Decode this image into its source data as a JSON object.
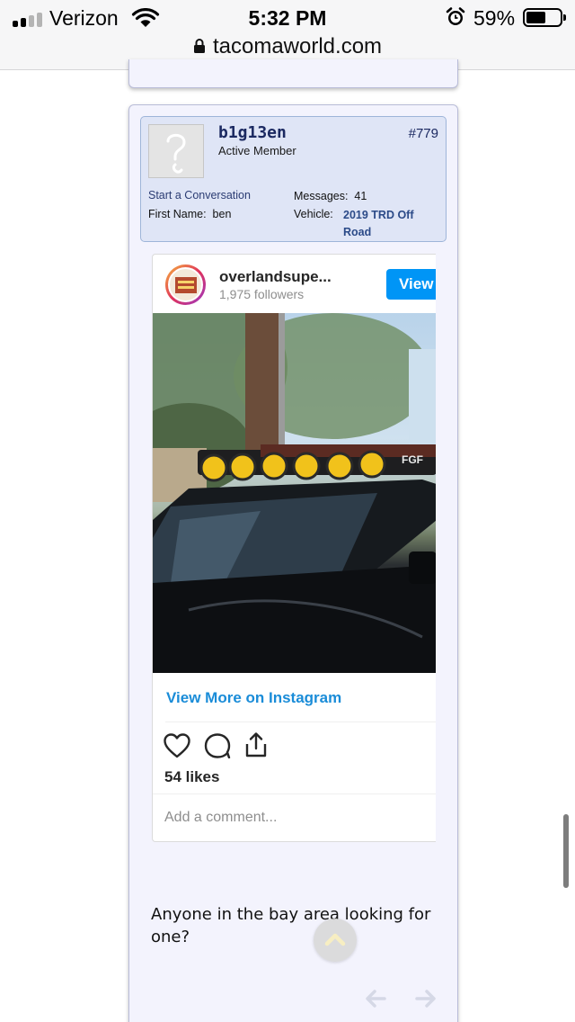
{
  "status_bar": {
    "carrier": "Verizon",
    "time": "5:32 PM",
    "battery_percent": "59%",
    "battery_level": 0.59,
    "signal_bars": 2,
    "icons": [
      "signal-icon",
      "wifi-icon",
      "alarm-icon",
      "battery-icon"
    ]
  },
  "url_bar": {
    "domain": "tacomaworld.com",
    "icon": "lock-icon"
  },
  "post": {
    "user": {
      "username": "b1g13en",
      "title": "Active Member",
      "post_number": "#779",
      "start_conversation": "Start a Conversation",
      "first_name_label": "First Name:",
      "first_name": "ben",
      "messages_label": "Messages:",
      "messages": "41",
      "vehicle_label": "Vehicle:",
      "vehicle": "2019 TRD Off Road"
    },
    "instagram": {
      "handle": "overlandsupe...",
      "followers": "1,975 followers",
      "view_button": "View",
      "view_more_link": "View More on Instagram",
      "likes": "54 likes",
      "comment_placeholder": "Add a comment...",
      "photo_text": "FGF",
      "icons": [
        "heart-icon",
        "comment-icon",
        "share-icon"
      ]
    },
    "body_text": "Anyone in the bay area looking for one?"
  },
  "controls": {
    "scroll_top_icon": "chevron-up-icon",
    "prev_icon": "arrow-left-icon",
    "next_icon": "arrow-right-icon"
  },
  "colors": {
    "post_bg": "#f3f3fd",
    "userblock_bg": "#dfe5f6",
    "username": "#1b2961",
    "instagram_blue": "#0095f6",
    "link_blue": "#1a8cd8"
  }
}
